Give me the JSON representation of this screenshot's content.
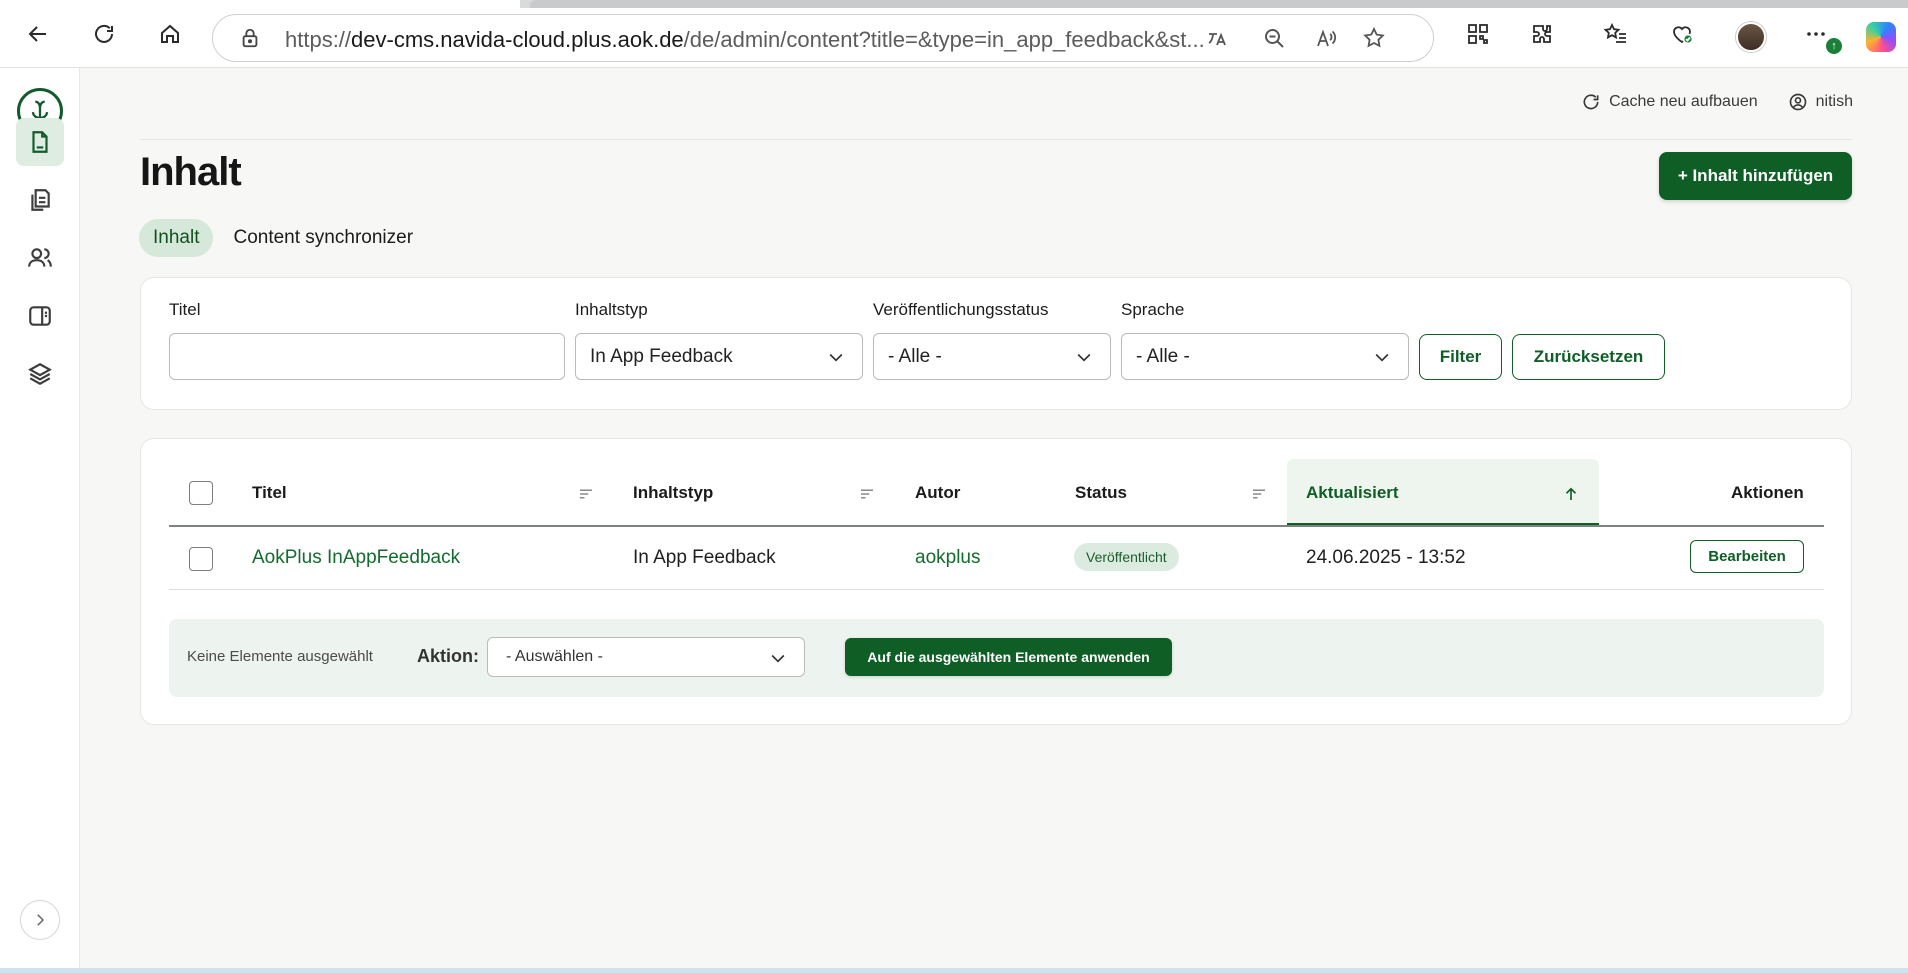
{
  "browser": {
    "url_prefix": "https://",
    "url_host": "dev-cms.navida-cloud.plus.aok.de",
    "url_path": "/de/admin/content?title=&type=in_app_feedback&st...",
    "update_badge": "↑"
  },
  "sidebar": {
    "items": [
      {
        "icon": "document-icon",
        "active": true
      },
      {
        "icon": "documents-stack-icon",
        "active": false
      },
      {
        "icon": "users-icon",
        "active": false
      },
      {
        "icon": "layout-panel-icon",
        "active": false
      },
      {
        "icon": "layers-icon",
        "active": false
      }
    ]
  },
  "utility": {
    "cache_label": "Cache neu aufbauen",
    "user_label": "nitish"
  },
  "page": {
    "title": "Inhalt",
    "add_button": "+ Inhalt hinzufügen",
    "tabs": [
      {
        "label": "Inhalt",
        "active": true
      },
      {
        "label": "Content synchronizer",
        "active": false
      }
    ]
  },
  "filters": {
    "title_label": "Titel",
    "title_value": "",
    "type_label": "Inhaltstyp",
    "type_value": "In App Feedback",
    "status_label": "Veröffentlichungsstatus",
    "status_value": "- Alle -",
    "language_label": "Sprache",
    "language_value": "- Alle -",
    "filter_button": "Filter",
    "reset_button": "Zurücksetzen"
  },
  "table": {
    "columns": {
      "title": "Titel",
      "type": "Inhaltstyp",
      "author": "Autor",
      "status": "Status",
      "updated": "Aktualisiert",
      "actions": "Aktionen"
    },
    "rows": [
      {
        "title": "AokPlus InAppFeedback",
        "type": "In App Feedback",
        "author": "aokplus",
        "status": "Veröffentlicht",
        "updated": "24.06.2025 - 13:52",
        "action": "Bearbeiten"
      }
    ]
  },
  "bulk": {
    "selection_text": "Keine Elemente ausgewählt",
    "action_label": "Aktion:",
    "action_value": "- Auswählen -",
    "apply_button": "Auf die ausgewählten Elemente anwenden"
  },
  "colors": {
    "brand_green": "#0f5e26",
    "accent_light": "#d6e8d9"
  }
}
